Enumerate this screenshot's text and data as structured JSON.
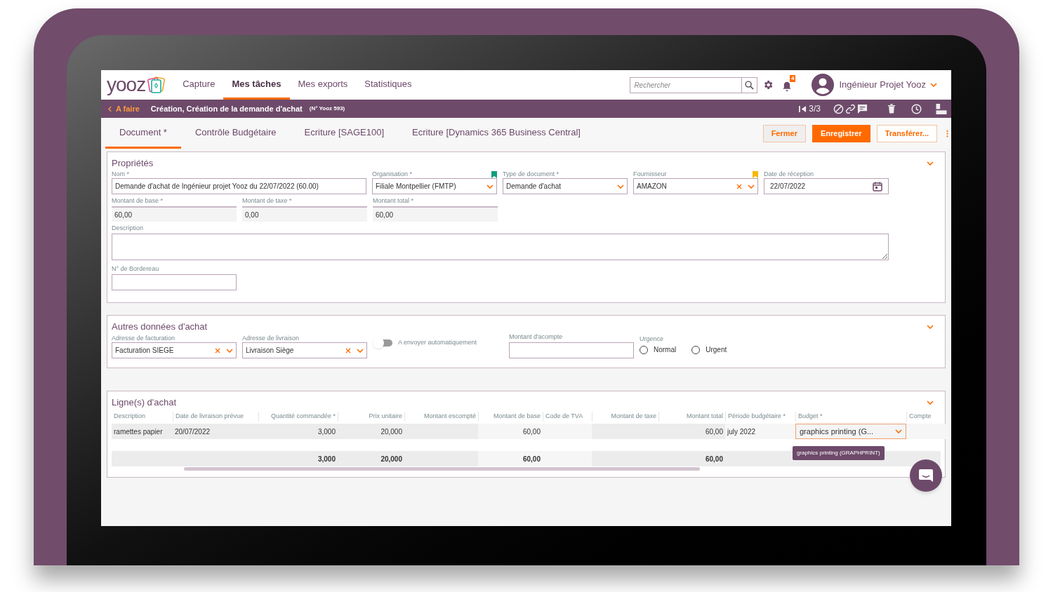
{
  "header": {
    "logo": "yooz",
    "nav": [
      {
        "label": "Capture",
        "selected": false
      },
      {
        "label": "Mes tâches",
        "selected": true
      },
      {
        "label": "Mes exports",
        "selected": false
      },
      {
        "label": "Statistiques",
        "selected": false
      }
    ],
    "search": {
      "placeholder": "Rechercher"
    },
    "notifications": "4",
    "user": "Ingénieur Projet Yooz"
  },
  "breadcrumb": {
    "back": "A faire",
    "title": "Création, Création de la demande d'achat",
    "number": "(N° Yooz 593)",
    "pager": "3/3"
  },
  "tabs": [
    {
      "label": "Document *",
      "selected": true
    },
    {
      "label": "Contrôle Budgétaire",
      "selected": false
    },
    {
      "label": "Ecriture [SAGE100]",
      "selected": false
    },
    {
      "label": "Ecriture [Dynamics 365 Business Central]",
      "selected": false
    }
  ],
  "buttons": [
    {
      "label": "Fermer",
      "kind": "secondary"
    },
    {
      "label": "Enregistrer",
      "kind": "primary"
    },
    {
      "label": "Transférer...",
      "kind": "outline"
    }
  ],
  "properties": {
    "title": "Propriétés",
    "fields": [
      {
        "label": "Nom *",
        "value": "Demande d'achat de Ingénieur projet Yooz du 22/07/2022 (60.00)",
        "kind": "text"
      },
      {
        "label": "Organisation *",
        "value": "Filiale Montpellier (FMTP)",
        "kind": "select",
        "color": "#0f9d7a"
      },
      {
        "label": "Type de document *",
        "value": "Demande d'achat",
        "kind": "select"
      },
      {
        "label": "Fournisseur",
        "value": "AMAZON",
        "kind": "select",
        "clearable": true,
        "color": "#f5b800"
      },
      {
        "label": "Date de réception",
        "value": "22/07/2022",
        "kind": "date"
      }
    ],
    "amounts": [
      {
        "label": "Montant de base *",
        "value": "60,00",
        "kind": "readonly"
      },
      {
        "label": "Montant de taxe *",
        "value": "0,00",
        "kind": "readonly"
      },
      {
        "label": "Montant total *",
        "value": "60,00",
        "kind": "readonly"
      }
    ],
    "description": {
      "label": "Description"
    },
    "bordereau": {
      "label": "N° de Bordereau"
    }
  },
  "other": {
    "title": "Autres données d'achat",
    "billing": {
      "label": "Adresse de facturation",
      "value": "Facturation SIEGE",
      "kind": "select",
      "clearable": true
    },
    "delivery": {
      "label": "Adresse de livraison",
      "value": "Livraison Siège",
      "kind": "select",
      "clearable": true
    },
    "auto_send": {
      "label": "A envoyer automatiquement",
      "on": false
    },
    "deposit": {
      "label": "Montant d'acompte"
    },
    "urgency": {
      "label": "Urgence",
      "options": [
        {
          "label": "Normal",
          "selected": false
        },
        {
          "label": "Urgent",
          "selected": false
        }
      ]
    }
  },
  "lines": {
    "title": "Ligne(s) d'achat",
    "columns": [
      "Description",
      "Date de livraison prévue",
      "Quantité commandée *",
      "Prix unitaire",
      "Montant escompté",
      "Montant de base",
      "Code de TVA",
      "Montant de taxe",
      "Montant total",
      "Période budgétaire *",
      "Budget *",
      "Compte"
    ],
    "rows": [
      {
        "description": "ramettes papier",
        "delivery_date": "20/07/2022",
        "quantity": "3,000",
        "unit_price": "20,000",
        "base_amount": "60,00",
        "total_amount": "60,00",
        "period": "july 2022",
        "budget": "graphics printing (G..."
      }
    ],
    "totals": {
      "quantity": "3,000",
      "unit_price": "20,000",
      "base_amount": "60,00",
      "total_amount": "60,00"
    },
    "tooltip": "graphics printing (GRAPHPRINT)"
  }
}
